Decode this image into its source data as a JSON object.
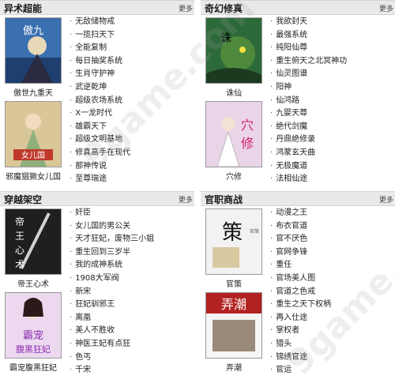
{
  "panels": [
    {
      "title": "异术超能",
      "more": "更多",
      "books": [
        {
          "name": "傲世九重天",
          "cover_color": "#3a6fb0",
          "cover_text": "傲世九重天"
        },
        {
          "name": "邪魔猖獗女儿国",
          "cover_color": "#c9a45a",
          "cover_text": "女儿国"
        }
      ],
      "items": [
        "无敌储物戒",
        "一揽扫天下",
        "全能复制",
        "每日抽奖系统",
        "生肖守护神",
        "武逆乾坤",
        "超级农场系统",
        "X一龙时代",
        "雄霸天下",
        "超级文明基地",
        "修真高手在现代",
        "那神传说",
        "至尊瑞途"
      ]
    },
    {
      "title": "奇幻修真",
      "more": "更多",
      "books": [
        {
          "name": "诛仙",
          "cover_color": "#2d6a3a",
          "cover_text": "诛仙"
        },
        {
          "name": "穴修",
          "cover_color": "#b84a8a",
          "cover_text": "穴修"
        }
      ],
      "items": [
        "我欲封天",
        "最强系统",
        "纯阳仙尊",
        "重生俯天之北冥神功",
        "仙灵图谱",
        "阳神",
        "仙鸿路",
        "九婴天尊",
        "绝代剑魔",
        "丹鼎绝修录",
        "鸿蒙玄天曲",
        "无极魔道",
        "法相仙途"
      ]
    },
    {
      "title": "穿越架空",
      "more": "更多",
      "books": [
        {
          "name": "帝王心术",
          "cover_color": "#1f1f1f",
          "cover_text": "帝王心术"
        },
        {
          "name": "霸宠腹黑狂妃",
          "cover_color": "#8a4ab0",
          "cover_text": "霸宠腹黑狂妃"
        }
      ],
      "items": [
        "奸臣",
        "女儿国的男公关",
        "天才狂妃，废物三小姐",
        "重生回到三岁半",
        "我的成神系统",
        "1908大军阀",
        "新宋",
        "狂妃驯邪王",
        "离凰",
        "美人不胜收",
        "神医王妃有点狂",
        "色丐",
        "千宋"
      ]
    },
    {
      "title": "官职商战",
      "more": "更多",
      "books": [
        {
          "name": "官策",
          "cover_color": "#d8d8d8",
          "cover_text": "官策"
        },
        {
          "name": "弄潮",
          "cover_color": "#b32222",
          "cover_text": "弄潮"
        }
      ],
      "items": [
        "动漫之王",
        "布衣官道",
        "官不厌色",
        "官网争锋",
        "重任",
        "官场美人图",
        "官道之色戒",
        "重生之天下权柄",
        "再入仕途",
        "掌权者",
        "猎头",
        "锦绣官途",
        "官运"
      ]
    }
  ],
  "watermark": "9game.com"
}
